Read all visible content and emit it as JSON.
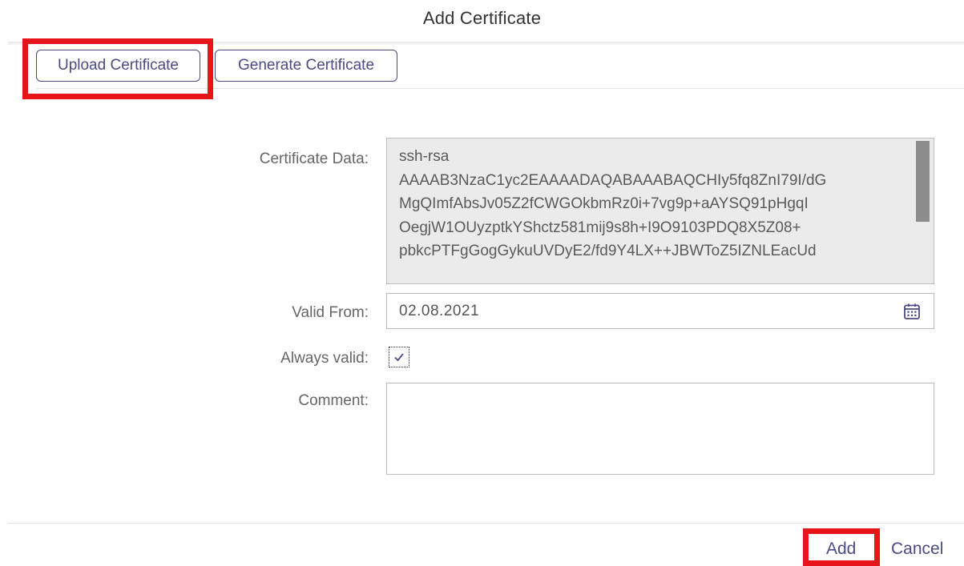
{
  "dialog": {
    "title": "Add Certificate"
  },
  "tabs": {
    "upload_label": "Upload Certificate",
    "generate_label": "Generate Certificate"
  },
  "form": {
    "certificate_data_label": "Certificate Data:",
    "certificate_data_value": "ssh-rsa\nAAAAB3NzaC1yc2EAAAADAQABAAABAQCHIy5fq8ZnI79I/dG\nMgQImfAbsJv05Z2fCWGOkbmRz0i+7vg9p+aAYSQ91pHgqI\nOegjW1OUyzptkYShctz581mij9s8h+I9O9103PDQ8X5Z08+\npbkcPTFgGogGykuUVDyE2/fd9Y4LX++JBWToZ5IZNLEacUd",
    "valid_from_label": "Valid From:",
    "valid_from_value": "02.08.2021",
    "always_valid_label": "Always valid:",
    "always_valid_checked": true,
    "comment_label": "Comment:",
    "comment_value": ""
  },
  "footer": {
    "add_label": "Add",
    "cancel_label": "Cancel"
  },
  "icons": {
    "calendar": "calendar-icon",
    "checkmark": "checkmark-icon"
  },
  "colors": {
    "accent": "#4b4b85",
    "highlight": "#e8141c",
    "readonly_bg": "#ebebeb"
  }
}
